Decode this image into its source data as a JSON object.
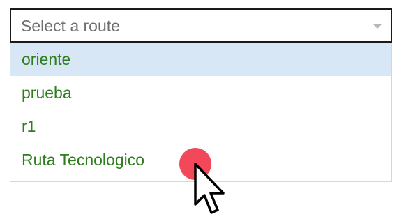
{
  "select": {
    "placeholder": "Select a route",
    "arrow_icon": "caret-down-icon"
  },
  "dropdown": {
    "options": [
      {
        "label": "oriente",
        "highlighted": true
      },
      {
        "label": "prueba",
        "highlighted": false
      },
      {
        "label": "r1",
        "highlighted": false
      },
      {
        "label": "Ruta Tecnologico",
        "highlighted": false
      }
    ]
  },
  "colors": {
    "option_text": "#2e7d1e",
    "highlight_bg": "#d7e7f6",
    "click_indicator": "#f2485a",
    "placeholder_text": "#6f6f6f"
  },
  "icons": {
    "cursor": "mouse-pointer-icon",
    "click": "click-indicator-dot"
  }
}
